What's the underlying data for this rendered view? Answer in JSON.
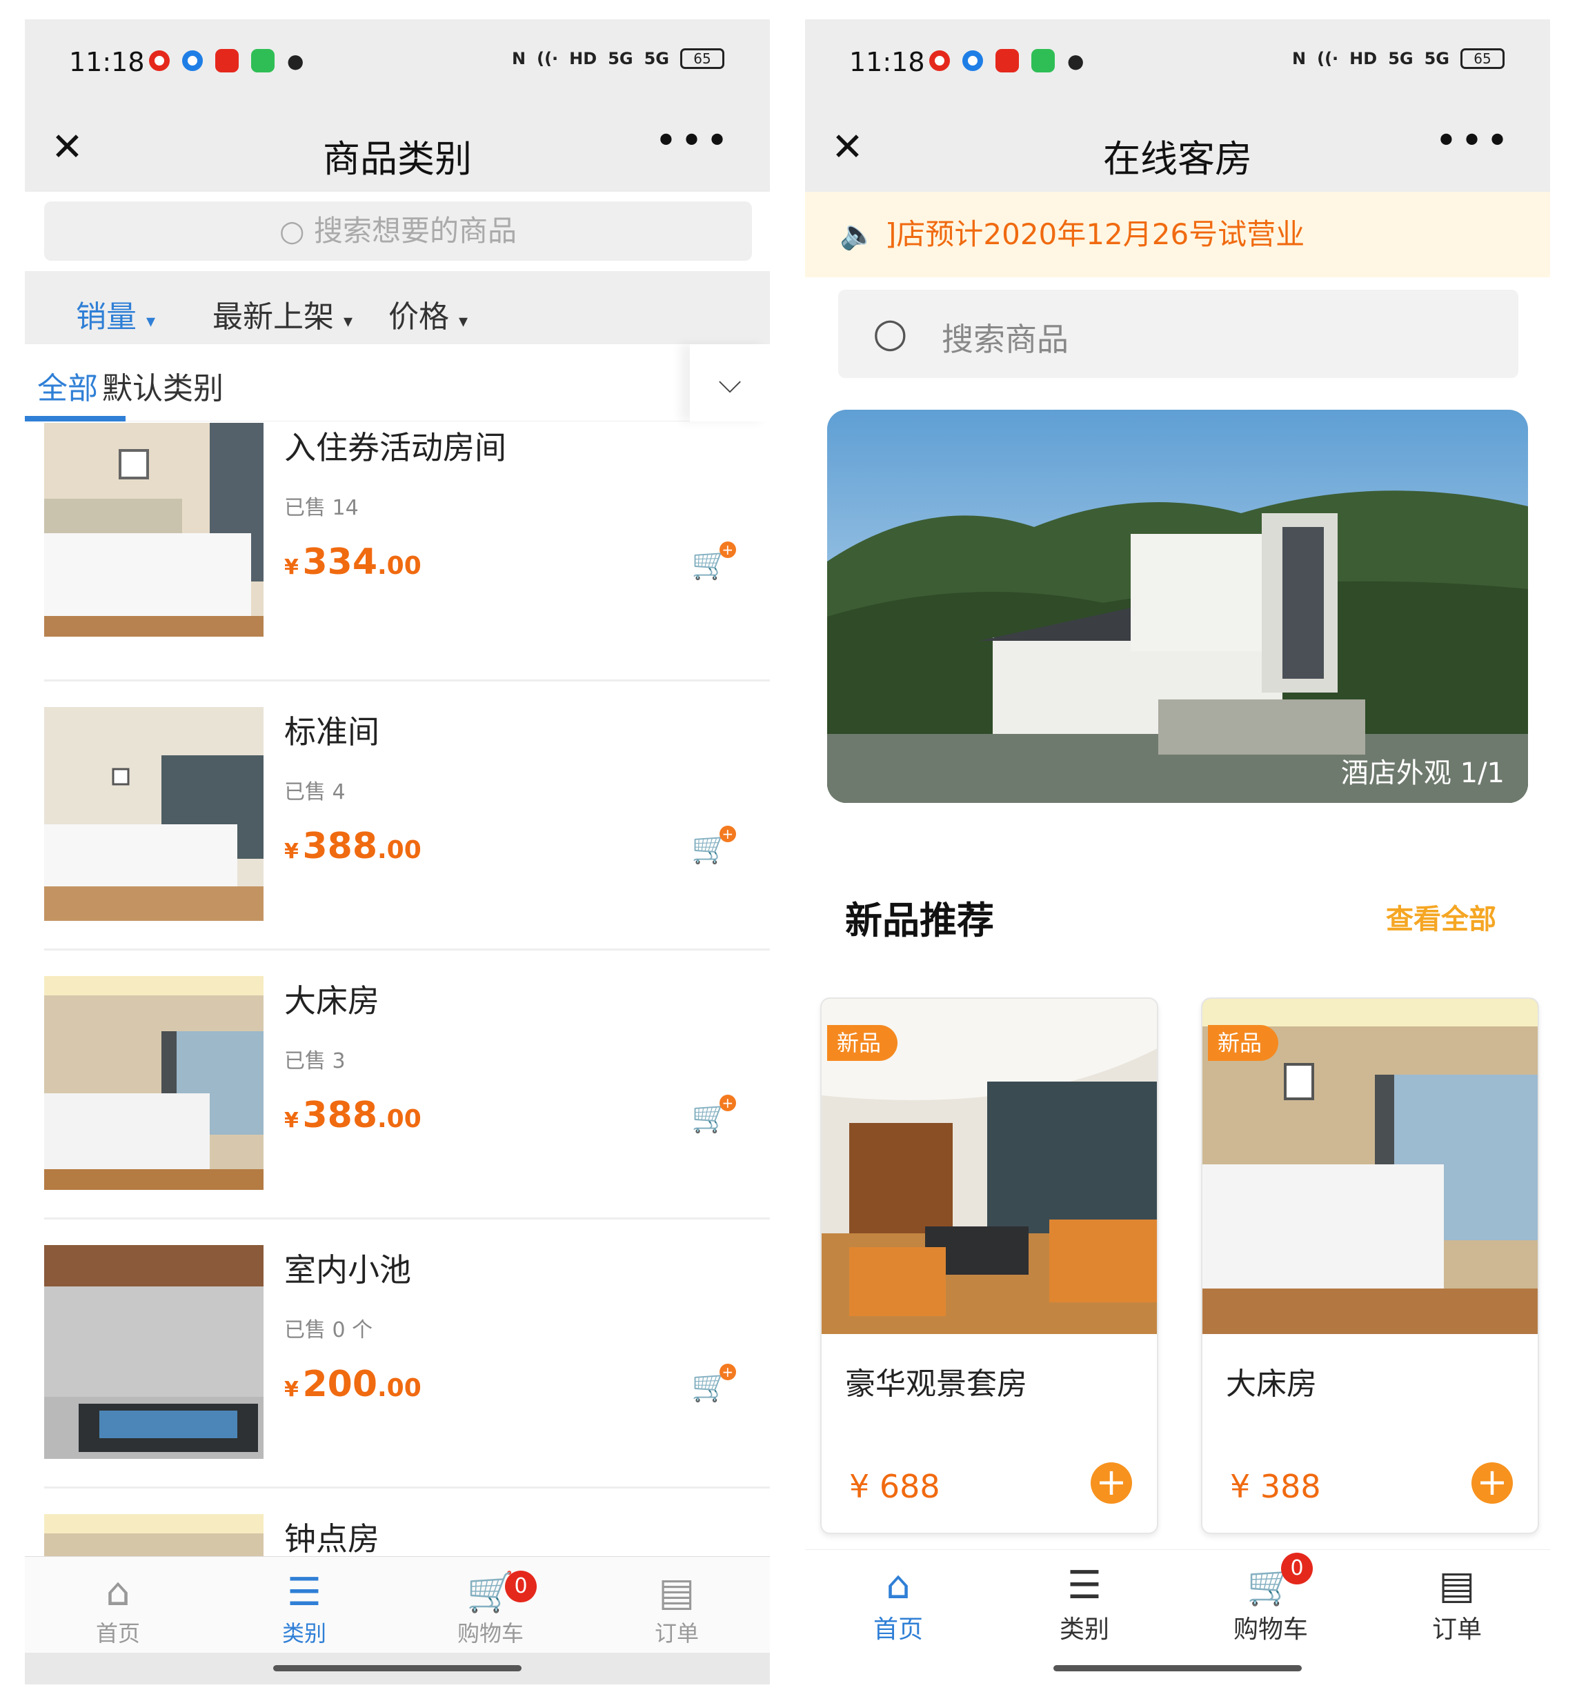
{
  "status_bar": {
    "time": "11:18",
    "battery": "65",
    "hd": "HD",
    "net1": "5G",
    "net2": "5G"
  },
  "left_screen": {
    "title": "商品类别",
    "search_placeholder": "搜索想要的商品",
    "sort_tabs": [
      {
        "label": "销量",
        "active": true
      },
      {
        "label": "最新上架",
        "active": false
      },
      {
        "label": "价格",
        "active": false
      }
    ],
    "category_tabs": [
      {
        "label": "全部",
        "active": true
      },
      {
        "label": "默认类别",
        "active": false
      }
    ],
    "products": [
      {
        "name": "入住券活动房间",
        "sold": "已售 14",
        "currency": "¥",
        "price_int": "334",
        "price_dec": ".00"
      },
      {
        "name": "标准间",
        "sold": "已售 4",
        "currency": "¥",
        "price_int": "388",
        "price_dec": ".00"
      },
      {
        "name": "大床房",
        "sold": "已售 3",
        "currency": "¥",
        "price_int": "388",
        "price_dec": ".00"
      },
      {
        "name": "室内小池",
        "sold": "已售 0 个",
        "currency": "¥",
        "price_int": "200",
        "price_dec": ".00"
      },
      {
        "name": "钟点房"
      }
    ],
    "nav": [
      {
        "label": "首页",
        "icon": "home-icon"
      },
      {
        "label": "类别",
        "icon": "category-icon",
        "active": true
      },
      {
        "label": "购物车",
        "icon": "cart-icon",
        "badge": "0"
      },
      {
        "label": "订单",
        "icon": "order-icon"
      }
    ]
  },
  "right_screen": {
    "title": "在线客房",
    "notice": "]店预计2020年12月26号试营业",
    "search_placeholder": "搜索商品",
    "banner_caption": "酒店外观",
    "banner_counter": "1/1",
    "section_title": "新品推荐",
    "section_more": "查看全部",
    "cards": [
      {
        "tag": "新品",
        "name": "豪华观景套房",
        "price": "¥ 688"
      },
      {
        "tag": "新品",
        "name": "大床房",
        "price": "¥ 388"
      }
    ],
    "nav": [
      {
        "label": "首页",
        "icon": "home-icon",
        "active": true
      },
      {
        "label": "类别",
        "icon": "category-icon"
      },
      {
        "label": "购物车",
        "icon": "cart-icon",
        "badge": "0"
      },
      {
        "label": "订单",
        "icon": "order-icon"
      }
    ]
  },
  "colors": {
    "accent_blue": "#2f7fd6",
    "price_orange": "#f06a10",
    "badge_red": "#e5281c",
    "tag_orange": "#f5891f"
  }
}
